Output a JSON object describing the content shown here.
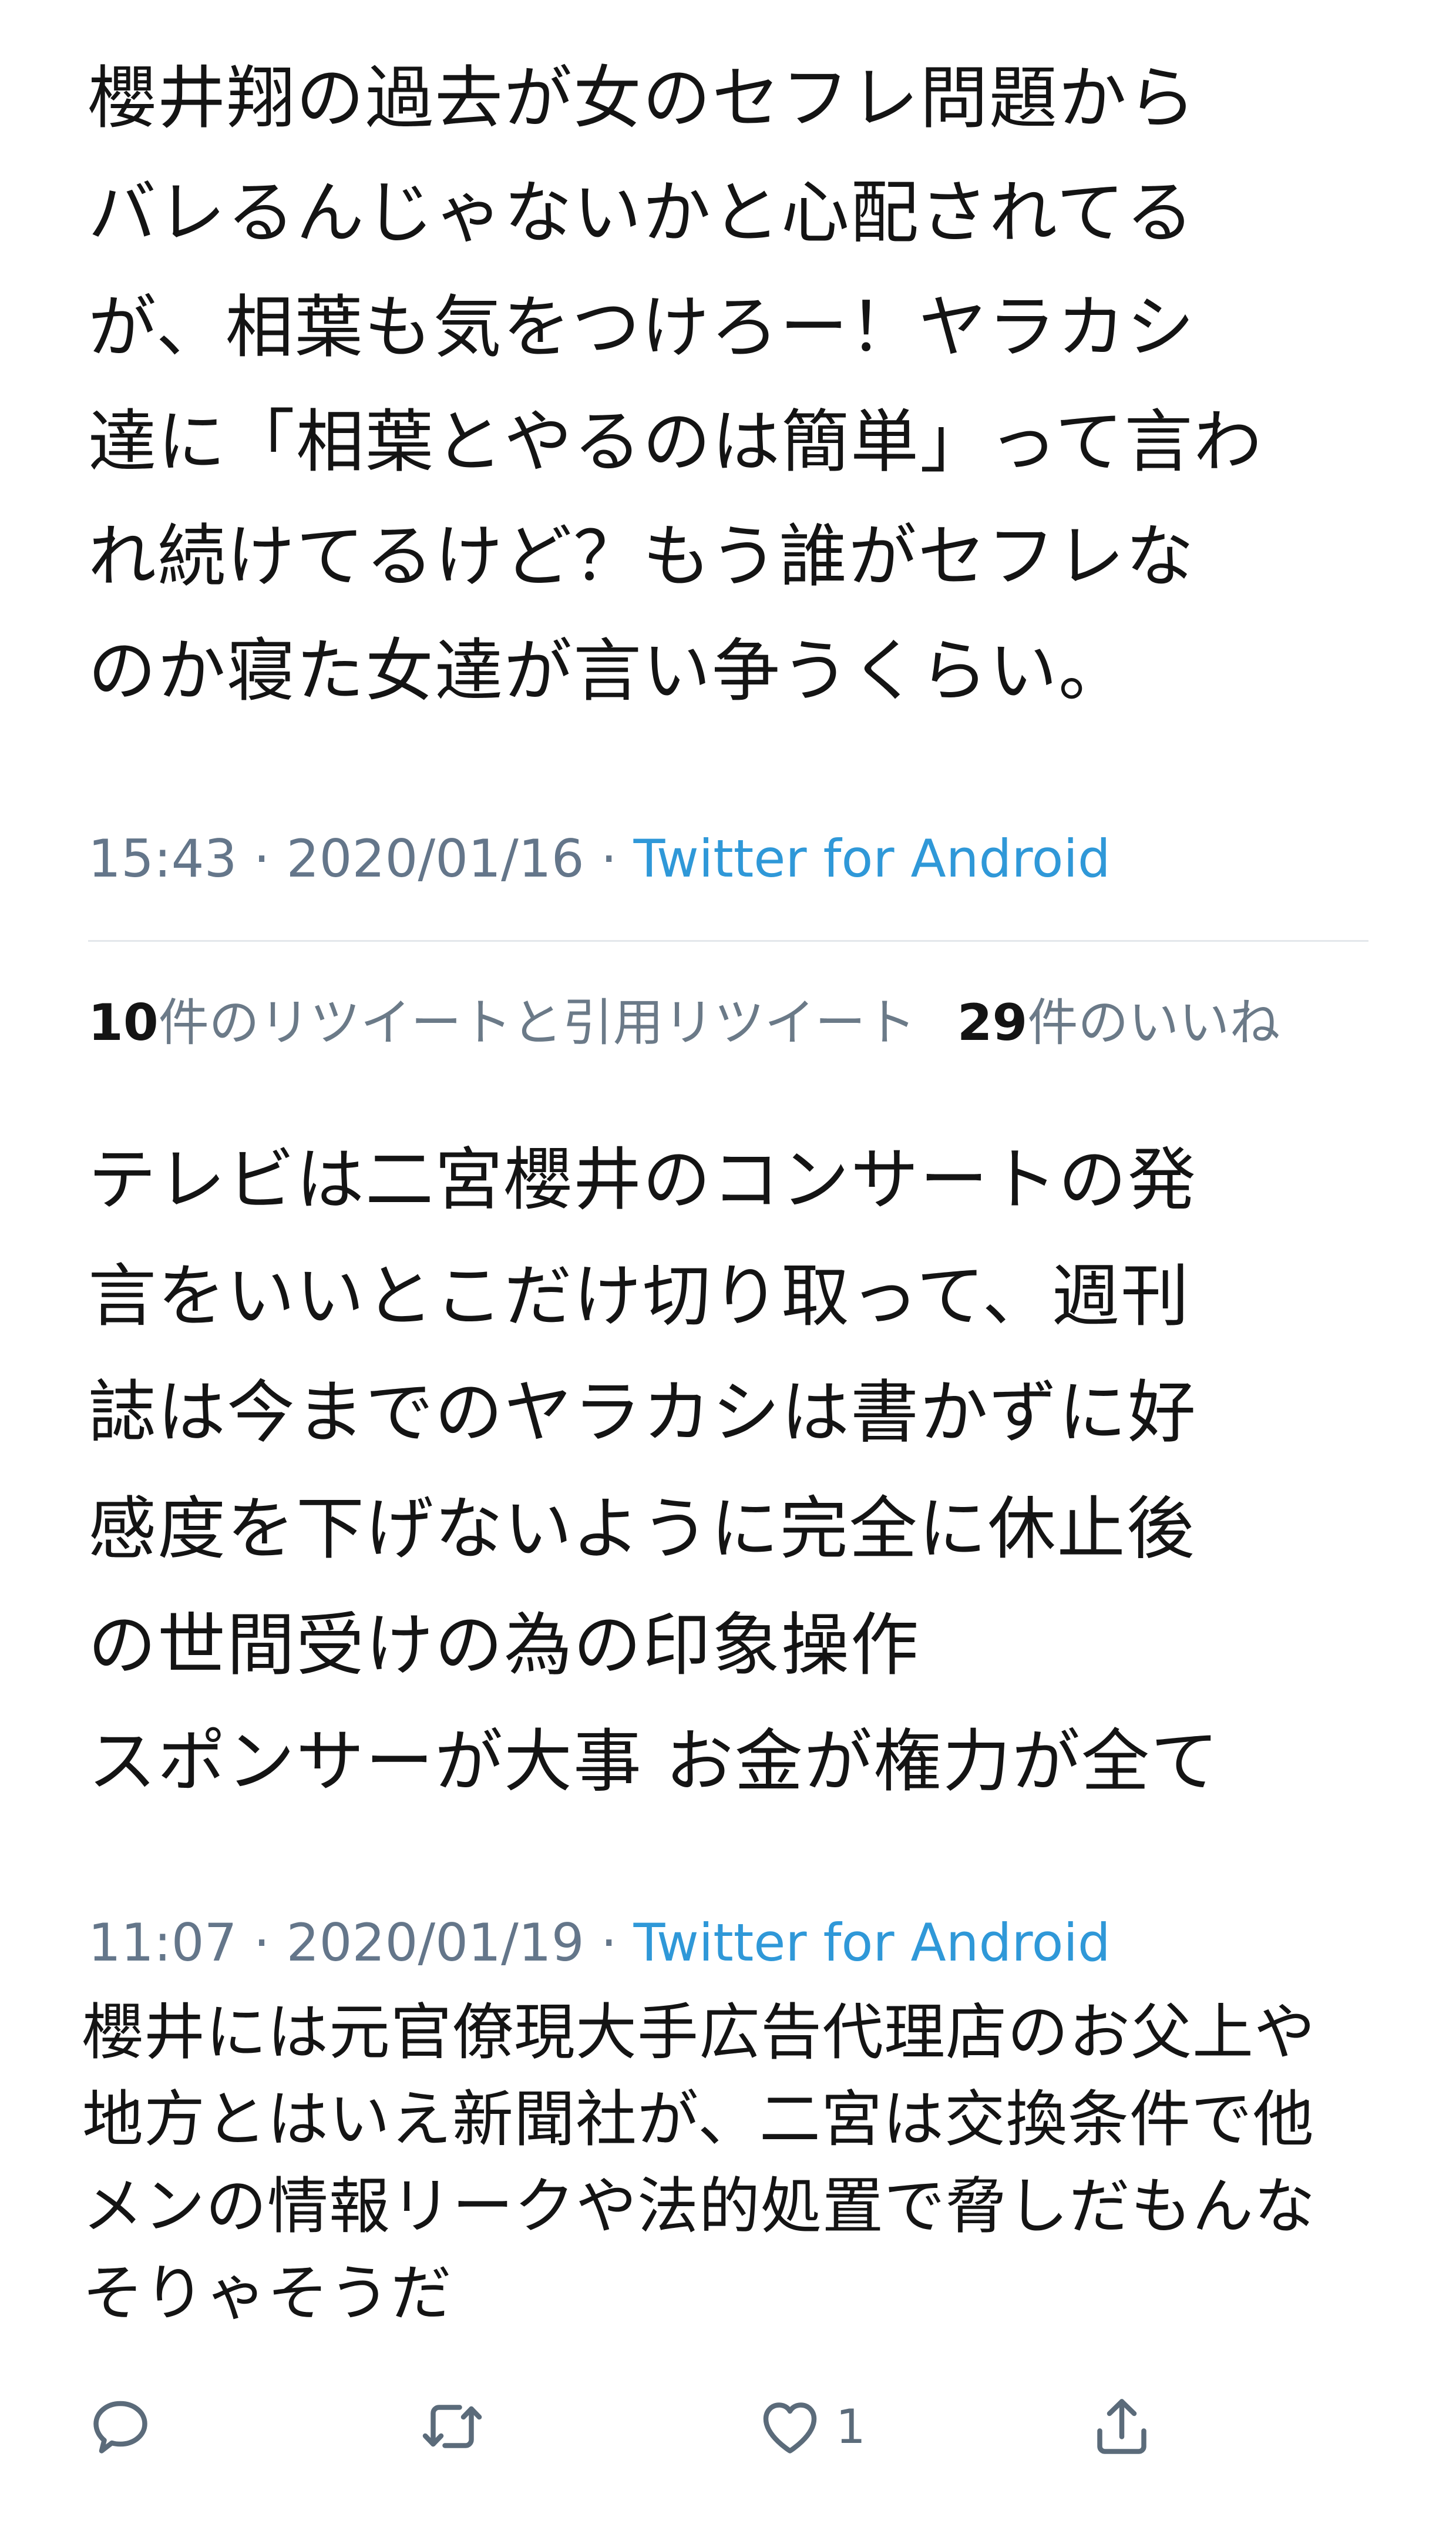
{
  "tweet1": {
    "lines": [
      "櫻井翔の過去が女のセフレ問題から",
      "バレるんじゃないかと心配されてる",
      "が、相葉も気をつけろー！ヤラカシ",
      "達に「相葉とやるのは簡単」って言わ",
      "れ続けてるけど？もう誰がセフレな",
      "のか寝た女達が言い争うくらい。"
    ],
    "time": "15:43 · 2020/01/16 · ",
    "source": "Twitter for Android",
    "retweets_count": "10",
    "retweets_label": "件のリツイートと引用リツイート",
    "likes_count": "29",
    "likes_label": "件のいいね"
  },
  "tweet2": {
    "lines": [
      "テレビは二宮櫻井のコンサートの発",
      "言をいいとこだけ切り取って、週刊",
      "誌は今までのヤラカシは書かずに好",
      "感度を下げないように完全に休止後",
      "の世間受けの為の印象操作",
      "スポンサーが大事 お金が権力が全て"
    ],
    "time": "11:07 · 2020/01/19 · ",
    "source": "Twitter for Android"
  },
  "reply": {
    "lines": [
      "櫻井には元官僚現大手広告代理店のお父上や",
      "地方とはいえ新聞社が、二宮は交換条件で他",
      "メンの情報リークや法的処置で脅しだもんな",
      "そりゃそうだ"
    ]
  },
  "actions": {
    "reply_icon": "reply-icon",
    "retweet_icon": "retweet-icon",
    "like_icon": "heart-icon",
    "like_count": "1",
    "share_icon": "share-icon"
  }
}
